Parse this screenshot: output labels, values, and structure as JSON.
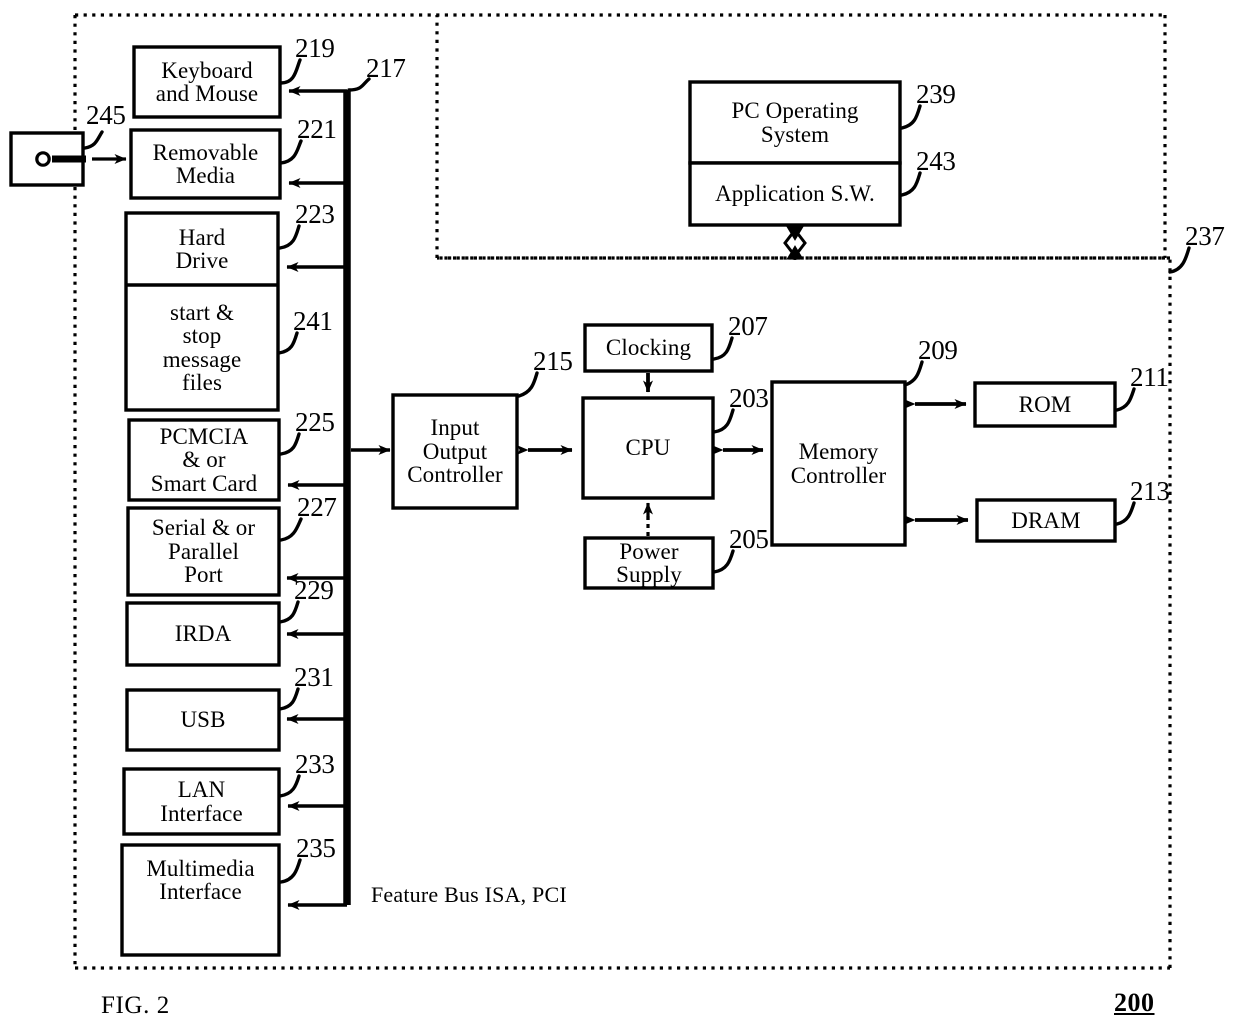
{
  "figure": {
    "caption": "FIG. 2",
    "figure_number": "200",
    "bus_label": "Feature Bus ISA, PCI"
  },
  "blocks": {
    "keyboard_mouse": {
      "line1": "Keyboard",
      "line2": "and Mouse",
      "ref": "219"
    },
    "removable_media": {
      "line1": "Removable",
      "line2": "Media",
      "ref": "221"
    },
    "hard_drive": {
      "line1": "Hard",
      "line2": "Drive",
      "ref": "223"
    },
    "message_files": {
      "line1": "start &",
      "line2": "stop",
      "line3": "message",
      "line4": "files",
      "ref": "241"
    },
    "pcmcia": {
      "line1": "PCMCIA",
      "line2": "& or",
      "line3": "Smart Card",
      "ref": "225"
    },
    "serial_parallel": {
      "line1": "Serial & or",
      "line2": "Parallel",
      "line3": "Port",
      "ref": "227"
    },
    "irda": {
      "line1": "IRDA",
      "ref": "229"
    },
    "usb": {
      "line1": "USB",
      "ref": "231"
    },
    "lan": {
      "line1": "LAN",
      "line2": "Interface",
      "ref": "233"
    },
    "multimedia": {
      "line1": "Multimedia",
      "line2": "Interface",
      "ref": "235"
    },
    "io_controller": {
      "line1": "Input",
      "line2": "Output",
      "line3": "Controller",
      "ref": "215"
    },
    "clocking": {
      "line1": "Clocking",
      "ref": "207"
    },
    "cpu": {
      "line1": "CPU",
      "ref": "203"
    },
    "power_supply": {
      "line1": "Power",
      "line2": "Supply",
      "ref": "205"
    },
    "memory_controller": {
      "line1": "Memory",
      "line2": "Controller",
      "ref": "209"
    },
    "rom": {
      "line1": "ROM",
      "ref": "211"
    },
    "dram": {
      "line1": "DRAM",
      "ref": "213"
    },
    "pc_os": {
      "line1": "PC Operating",
      "line2": "System",
      "ref": "239"
    },
    "application_sw": {
      "line1": "Application S.W.",
      "ref": "243"
    },
    "media_cartridge": {
      "ref": "245"
    }
  },
  "refs": {
    "feature_bus": "217",
    "system_boundary": "237"
  },
  "colors": {
    "ink": "#000000",
    "paper": "#ffffff"
  }
}
